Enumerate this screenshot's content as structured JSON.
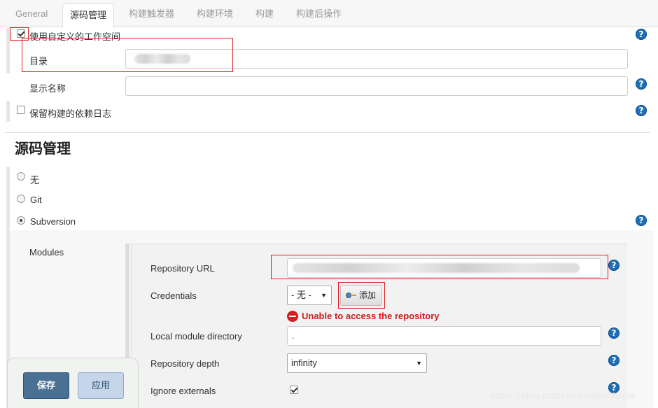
{
  "tabs": [
    {
      "label": "General",
      "active": false
    },
    {
      "label": "源码管理",
      "active": true
    },
    {
      "label": "构建触发器",
      "active": false
    },
    {
      "label": "构建环境",
      "active": false
    },
    {
      "label": "构建",
      "active": false
    },
    {
      "label": "构建后操作",
      "active": false
    }
  ],
  "general": {
    "custom_workspace_label": "使用自定义的工作空间",
    "custom_workspace_checked": true,
    "directory_label": "目录",
    "directory_value": "",
    "display_name_label": "显示名称",
    "display_name_value": "",
    "keep_log_label": "保留构建的依赖日志",
    "keep_log_checked": false
  },
  "scm": {
    "section_title": "源码管理",
    "options": [
      {
        "label": "无",
        "selected": false
      },
      {
        "label": "Git",
        "selected": false
      },
      {
        "label": "Subversion",
        "selected": true
      }
    ],
    "modules_label": "Modules",
    "repository_url_label": "Repository URL",
    "repository_url_value": "",
    "credentials_label": "Credentials",
    "credentials_selected": "- 无 -",
    "add_label": "添加",
    "error_text": "Unable to access the repository",
    "local_module_dir_label": "Local module directory",
    "local_module_dir_value": ".",
    "depth_label": "Repository depth",
    "depth_selected": "infinity",
    "ignore_externals_label": "Ignore externals",
    "ignore_externals_checked": true
  },
  "buttons": {
    "save": "保存",
    "apply": "应用"
  },
  "help_glyph": "?",
  "watermark": "https://blog.csdn.net/xiaoshiyiqie",
  "colors": {
    "help": "#1f6fb8",
    "error": "#cc1b1b",
    "save_button": "#4a7094",
    "apply_button": "#c5d6ea",
    "highlight_box": "#e02020"
  }
}
